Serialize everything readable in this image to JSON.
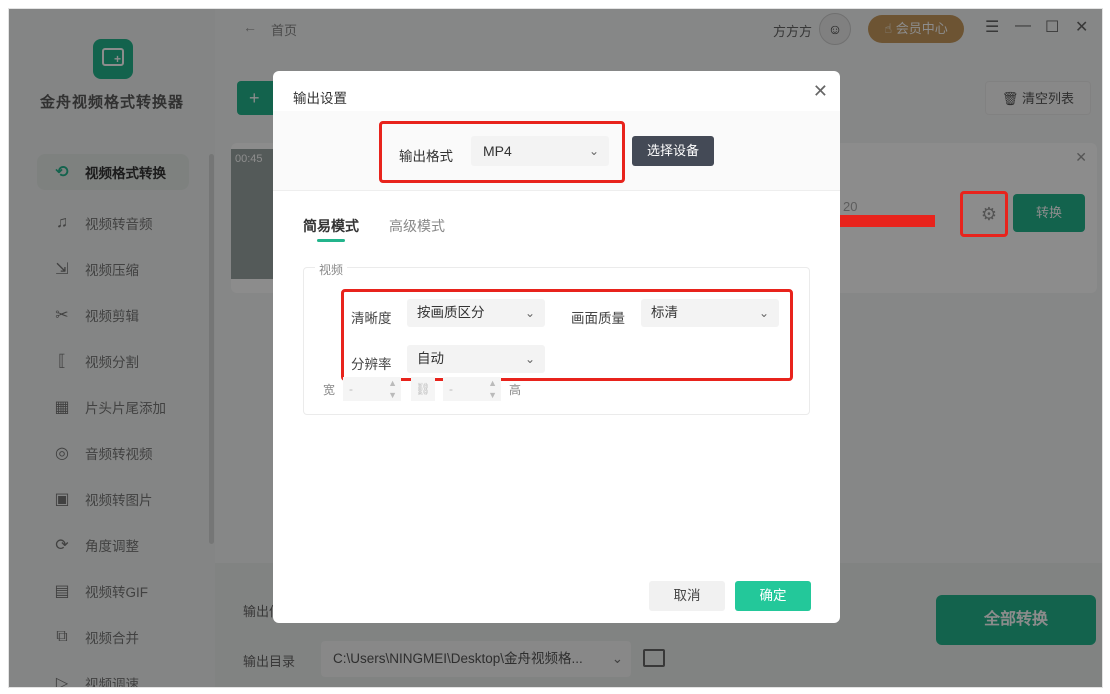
{
  "app": {
    "name": "金舟视频格式转换器"
  },
  "sidebar": {
    "items": [
      {
        "label": "视频格式转换",
        "icon": "format-convert-icon",
        "glyph": "⟲"
      },
      {
        "label": "视频转音频",
        "icon": "music-icon",
        "glyph": "♫"
      },
      {
        "label": "视频压缩",
        "icon": "compress-icon",
        "glyph": "⇲"
      },
      {
        "label": "视频剪辑",
        "icon": "scissors-icon",
        "glyph": "✂"
      },
      {
        "label": "视频分割",
        "icon": "split-icon",
        "glyph": "⟦"
      },
      {
        "label": "片头片尾添加",
        "icon": "film-icon",
        "glyph": "▦"
      },
      {
        "label": "音频转视频",
        "icon": "disc-icon",
        "glyph": "◎"
      },
      {
        "label": "视频转图片",
        "icon": "image-icon",
        "glyph": "▣"
      },
      {
        "label": "角度调整",
        "icon": "rotate-icon",
        "glyph": "⟳"
      },
      {
        "label": "视频转GIF",
        "icon": "gif-icon",
        "glyph": "▤"
      },
      {
        "label": "视频合并",
        "icon": "merge-icon",
        "glyph": "⧉"
      },
      {
        "label": "视频调速",
        "icon": "speed-icon",
        "glyph": "▷"
      }
    ]
  },
  "topbar": {
    "back_glyph": "←",
    "breadcrumb": "首页",
    "username": "方方方",
    "avatar_glyph": "☺",
    "vip_label": "会员中心",
    "menu_glyph": "☰",
    "minimize_glyph": "—",
    "maximize_glyph": "☐",
    "close_glyph": "✕"
  },
  "main": {
    "add_glyph": "+",
    "clear_label": "清空列表",
    "file": {
      "duration": "00:45",
      "partial_value": "20",
      "convert_label": "转换"
    },
    "output_settings_label": "输出信",
    "output_dir_label": "输出目录",
    "output_dir_value": "C:\\Users\\NINGMEI\\Desktop\\金舟视频格...",
    "convert_all_label": "全部转换"
  },
  "dialog": {
    "title": "输出设置",
    "close_glyph": "✕",
    "format_label": "输出格式",
    "format_value": "MP4",
    "device_button": "选择设备",
    "tabs": [
      {
        "label": "简易模式",
        "active": true
      },
      {
        "label": "高级模式",
        "active": false
      }
    ],
    "section_label": "视频",
    "clarity_label": "清晰度",
    "clarity_value": "按画质区分",
    "quality_label": "画面质量",
    "quality_value": "标清",
    "resolution_label": "分辨率",
    "resolution_value": "自动",
    "width_label": "宽",
    "height_label": "高",
    "width_value": "-",
    "height_value": "-",
    "cancel_label": "取消",
    "ok_label": "确定"
  },
  "colors": {
    "accent": "#23b48c",
    "highlight": "#e8231c",
    "vip": "#c69a5d"
  }
}
